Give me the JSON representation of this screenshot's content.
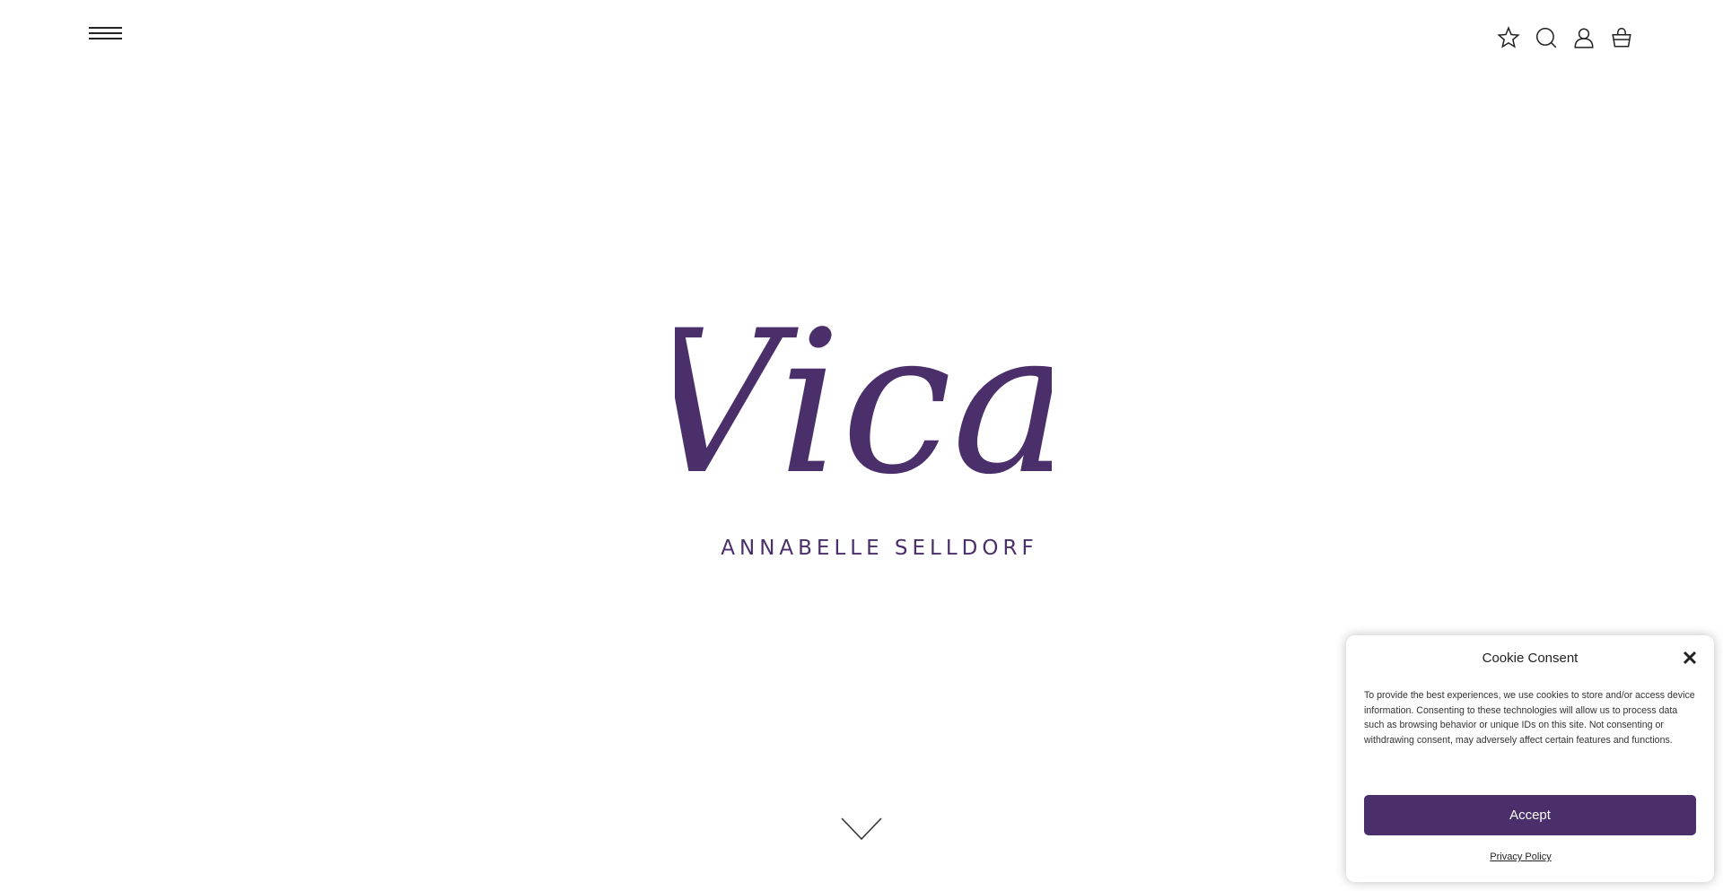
{
  "header": {
    "menu_icon": "hamburger-menu-icon",
    "icons": [
      "star-icon",
      "search-icon",
      "user-icon",
      "basket-icon"
    ]
  },
  "hero": {
    "logo_text": "Vica",
    "subtitle": "ANNABELLE SELLDORF",
    "brand_color": "#4a2f6b",
    "scroll_icon": "chevron-down-icon"
  },
  "cookie_consent": {
    "title": "Cookie Consent",
    "body": "To provide the best experiences, we use cookies to store and/or access device information. Consenting to these technologies will allow us to process data such as browsing behavior or unique IDs on this site. Not consenting or withdrawing consent, may adversely affect certain features and functions.",
    "accept_label": "Accept",
    "privacy_link": "Privacy Policy",
    "close_icon": "close-icon",
    "accent_color": "#4a2f6b"
  }
}
